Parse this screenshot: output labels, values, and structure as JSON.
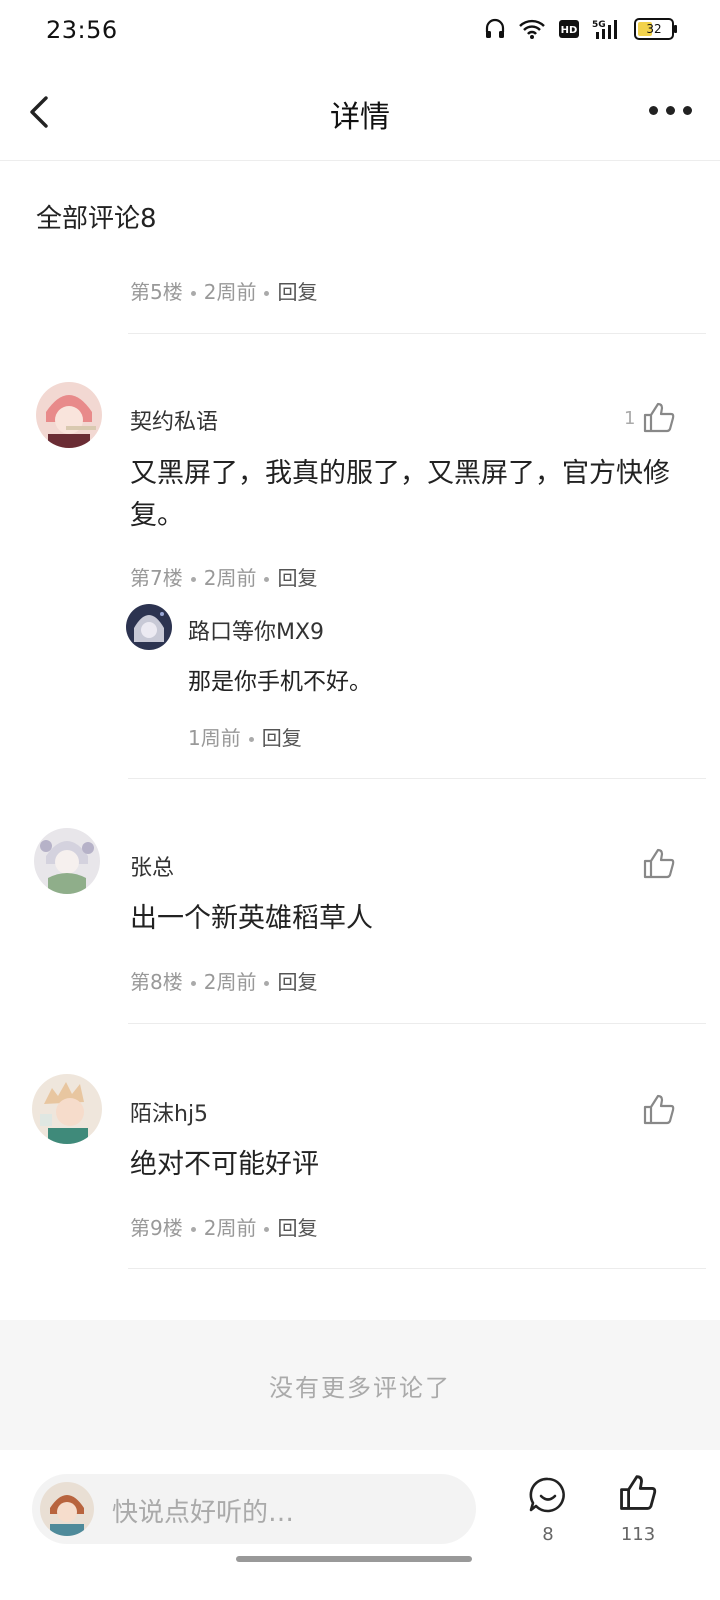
{
  "status_bar": {
    "time": "23:56",
    "battery": "32"
  },
  "header": {
    "title": "详情"
  },
  "comments_section": {
    "title": "全部评论8"
  },
  "prev_comment_meta": {
    "floor": "第5楼",
    "time": "2周前",
    "reply": "回复"
  },
  "comments": [
    {
      "user": "契约私语",
      "likes": "1",
      "text": "又黑屏了，我真的服了，又黑屏了，官方快修复。",
      "floor": "第7楼",
      "time": "2周前",
      "reply": "回复",
      "sub_reply": {
        "user": "路口等你MX9",
        "text": "那是你手机不好。",
        "time": "1周前",
        "reply": "回复"
      }
    },
    {
      "user": "张总",
      "text": "出一个新英雄稻草人",
      "floor": "第8楼",
      "time": "2周前",
      "reply": "回复"
    },
    {
      "user": "陌沫hj5",
      "text": "绝对不可能好评",
      "floor": "第9楼",
      "time": "2周前",
      "reply": "回复"
    }
  ],
  "no_more": "没有更多评论了",
  "bottom_bar": {
    "placeholder": "快说点好听的…",
    "comment_count": "8",
    "like_count": "113"
  }
}
